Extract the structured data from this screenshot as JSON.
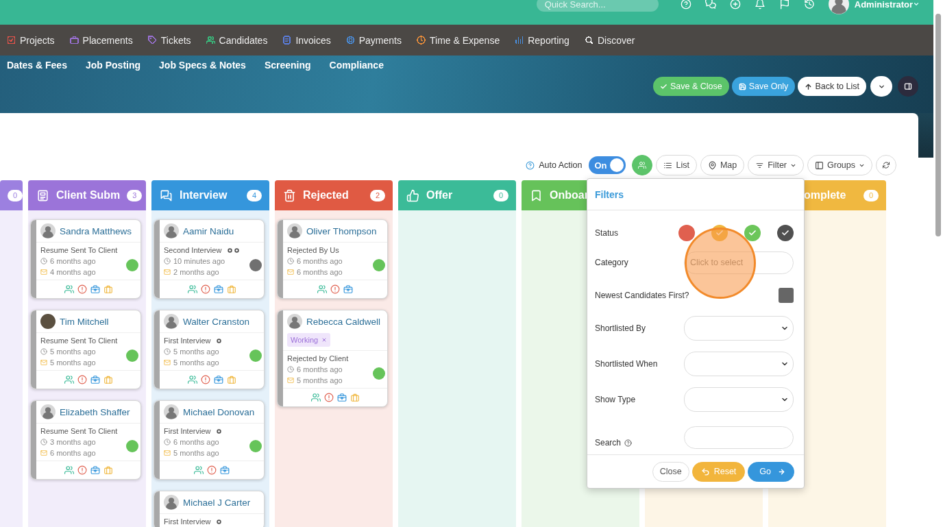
{
  "top_bar": {
    "search": {
      "placeholder": "Quick Search..."
    },
    "user": {
      "name": "Administrator"
    }
  },
  "nav": [
    {
      "label": "Projects",
      "kind": "checkbox",
      "color": "#e0524a"
    },
    {
      "label": "Placements",
      "kind": "briefcase",
      "color": "#9c72d8"
    },
    {
      "label": "Tickets",
      "kind": "tag",
      "color": "#9c72d8"
    },
    {
      "label": "Candidates",
      "kind": "users",
      "color": "#3ab77a"
    },
    {
      "label": "Invoices",
      "kind": "document",
      "color": "#5b7ee0"
    },
    {
      "label": "Payments",
      "kind": "coin",
      "color": "#4a90e2"
    },
    {
      "label": "Time & Expense",
      "kind": "clock",
      "color": "#f0903a"
    },
    {
      "label": "Reporting",
      "kind": "chart",
      "color": "#4a90e2"
    },
    {
      "label": "Discover",
      "kind": "search",
      "color": "#ffffff"
    }
  ],
  "sub_tabs": [
    {
      "label": "Dates & Fees"
    },
    {
      "label": "Job Posting"
    },
    {
      "label": "Job Specs & Notes"
    },
    {
      "label": "Screening"
    },
    {
      "label": "Compliance"
    }
  ],
  "actions": [
    {
      "kind": "save_close",
      "label": "Save & Close"
    },
    {
      "kind": "save",
      "label": "Save Only"
    },
    {
      "kind": "back",
      "label": "Back to List"
    },
    {
      "kind": "caret"
    },
    {
      "kind": "panel"
    }
  ],
  "toolbar": {
    "auto_action": "Auto Action",
    "toggle": {
      "label": "On",
      "on": true
    },
    "buttons": [
      {
        "kind": "people"
      },
      {
        "kind": "list",
        "label": "List"
      },
      {
        "kind": "map",
        "label": "Map"
      },
      {
        "kind": "filter",
        "label": "Filter"
      },
      {
        "kind": "groups",
        "label": "Groups"
      },
      {
        "kind": "refresh"
      }
    ]
  },
  "columns": [
    {
      "kind": "partial",
      "count": "0",
      "color": "#9c80e0"
    },
    {
      "kind": "submitted",
      "title": "Client Subm",
      "count": "3",
      "color": "#9b74d9",
      "cards": [
        {
          "name": "Sandra Matthews",
          "photo": false,
          "status": "Resume Sent To Client",
          "created": "6 months ago",
          "emailed": "4 months ago",
          "color": "#66c45a",
          "actions": [
            {
              "kind": "people"
            },
            {
              "kind": "alert"
            },
            {
              "kind": "medkit"
            },
            {
              "kind": "suitcase"
            }
          ]
        },
        {
          "name": "Tim Mitchell",
          "photo": true,
          "status": "Resume Sent To Client",
          "created": "5 months ago",
          "emailed": "5 months ago",
          "color": "#66c45a",
          "actions": [
            {
              "kind": "people"
            },
            {
              "kind": "alert"
            },
            {
              "kind": "medkit"
            },
            {
              "kind": "suitcase"
            }
          ]
        },
        {
          "name": "Elizabeth Shaffer",
          "photo": false,
          "status": "Resume Sent To Client",
          "created": "3 months ago",
          "emailed": "6 months ago",
          "color": "#66c45a",
          "actions": [
            {
              "kind": "people"
            },
            {
              "kind": "alert"
            },
            {
              "kind": "medkit"
            },
            {
              "kind": "suitcase"
            }
          ]
        }
      ]
    },
    {
      "kind": "interview",
      "title": "Interview",
      "count": "4",
      "color": "#3596dc",
      "cards": [
        {
          "name": "Aamir Naidu",
          "photo": false,
          "status": "Second Interview",
          "markers": [
            {
              "kind": "ring"
            },
            {
              "kind": "ring"
            }
          ],
          "created": "10 minutes ago",
          "emailed": "2 months ago",
          "color": "#707070",
          "actions": [
            {
              "kind": "people"
            },
            {
              "kind": "alert"
            },
            {
              "kind": "medkit"
            },
            {
              "kind": "suitcase"
            }
          ]
        },
        {
          "name": "Walter Cranston",
          "photo": false,
          "status": "First Interview",
          "markers": [
            {
              "kind": "ring"
            }
          ],
          "created": "5 months ago",
          "emailed": "5 months ago",
          "color": "#66c45a",
          "actions": [
            {
              "kind": "people"
            },
            {
              "kind": "alert"
            },
            {
              "kind": "medkit"
            },
            {
              "kind": "suitcase"
            }
          ]
        },
        {
          "name": "Michael Donovan",
          "photo": false,
          "status": "First Interview",
          "markers": [
            {
              "kind": "ring"
            }
          ],
          "created": "6 months ago",
          "emailed": "5 months ago",
          "color": "#66c45a",
          "actions": [
            {
              "kind": "people"
            },
            {
              "kind": "alert"
            },
            {
              "kind": "medkit"
            }
          ]
        },
        {
          "name": "Michael J Carter",
          "photo": false,
          "status": "First Interview",
          "markers": [
            {
              "kind": "ring"
            }
          ]
        }
      ]
    },
    {
      "kind": "rejected",
      "title": "Rejected",
      "count": "2",
      "color": "#e05a43",
      "cards": [
        {
          "name": "Oliver Thompson",
          "photo": false,
          "status": "Rejected By Us",
          "created": "6 months ago",
          "emailed": "6 months ago",
          "color": "#66c45a",
          "actions": [
            {
              "kind": "people"
            },
            {
              "kind": "alert"
            },
            {
              "kind": "medkit"
            }
          ]
        },
        {
          "name": "Rebecca Caldwell",
          "photo": false,
          "tag": {
            "label": "Working"
          },
          "status": "Rejected by Client",
          "created": "6 months ago",
          "emailed": "5 months ago",
          "color": "#66c45a",
          "actions": [
            {
              "kind": "people"
            },
            {
              "kind": "alert"
            },
            {
              "kind": "medkit"
            },
            {
              "kind": "suitcase"
            }
          ]
        }
      ]
    },
    {
      "kind": "offer",
      "title": "Offer",
      "count": "0",
      "color": "#3bbb98"
    },
    {
      "kind": "onboarding",
      "title": "Onboar",
      "color": "#66c25a"
    },
    {
      "kind": "hidden",
      "color": "#fdf5e6"
    },
    {
      "kind": "complete",
      "title": "omplete",
      "count": "0",
      "color": "#f0b840"
    }
  ],
  "filters": {
    "title": "Filters",
    "fields": [
      {
        "kind": "status",
        "label": "Status",
        "options": [
          {
            "color": "#e0604f",
            "selected": false
          },
          {
            "color": "#f0b840",
            "selected": true
          },
          {
            "color": "#6cc65a",
            "selected": true
          },
          {
            "color": "#505050",
            "selected": true
          }
        ]
      },
      {
        "kind": "picker",
        "label": "Category",
        "placeholder": "Click to select"
      },
      {
        "kind": "checkbox",
        "label": "Newest Candidates First?",
        "checked": false
      },
      {
        "kind": "select",
        "label": "Shortlisted By"
      },
      {
        "kind": "select",
        "label": "Shortlisted When"
      },
      {
        "kind": "select",
        "label": "Show Type"
      },
      {
        "kind": "search",
        "label": "Search",
        "help": true
      }
    ],
    "buttons": [
      {
        "kind": "close",
        "label": "Close"
      },
      {
        "kind": "reset",
        "label": "Reset"
      },
      {
        "kind": "go",
        "label": "Go"
      }
    ]
  }
}
